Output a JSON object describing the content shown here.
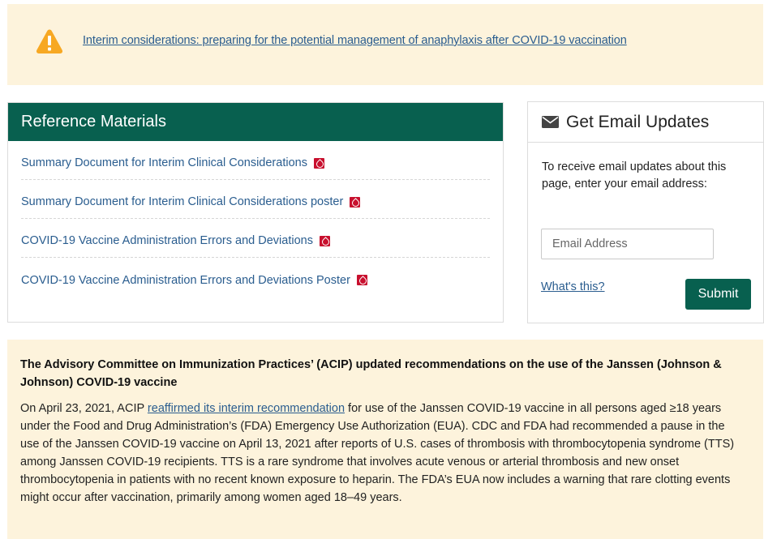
{
  "alert": {
    "link_text": "Interim considerations: preparing for the potential management of anaphylaxis after COVID-19 vaccination",
    "icon": "warning-triangle-icon",
    "icon_color": "#f7a823"
  },
  "reference_materials": {
    "title": "Reference Materials",
    "header_color": "#08604f",
    "items": [
      {
        "label": "Summary Document for Interim Clinical Considerations",
        "icon": "pdf-icon"
      },
      {
        "label": "Summary Document for Interim Clinical Considerations poster",
        "icon": "pdf-icon"
      },
      {
        "label": "COVID-19 Vaccine Administration Errors and Deviations",
        "icon": "pdf-icon"
      },
      {
        "label": "COVID-19 Vaccine Administration Errors and Deviations Poster",
        "icon": "pdf-icon"
      }
    ]
  },
  "email_updates": {
    "title": "Get Email Updates",
    "icon": "envelope-icon",
    "description": "To receive email updates about this page, enter your email address:",
    "input_placeholder": "Email Address",
    "whats_this_label": "What's this?",
    "submit_label": "Submit",
    "button_color": "#08604f"
  },
  "acip": {
    "title": "The Advisory Committee on Immunization Practices’ (ACIP) updated recommendations on the use of the Janssen (Johnson & Johnson) COVID-19 vaccine",
    "body_before_link": "On April 23, 2021, ACIP ",
    "body_link": "reaffirmed its interim recommendation",
    "body_after_link": " for use of the Janssen COVID-19 vaccine in all persons aged ≥18 years under the Food and Drug Administration’s (FDA) Emergency Use Authorization (EUA). CDC and FDA had recommended a pause in the use of the Janssen COVID-19 vaccine on April 13, 2021 after reports of U.S. cases of thrombosis with thrombocytopenia syndrome (TTS) among Janssen COVID-19 recipients. TTS is a rare syndrome that involves acute venous or arterial thrombosis and new onset thrombocytopenia in patients with no recent known exposure to heparin. The FDA’s EUA now includes a warning that rare clotting events might occur after vaccination, primarily among women aged 18–49 years.",
    "background_color": "#fdf3dc"
  }
}
